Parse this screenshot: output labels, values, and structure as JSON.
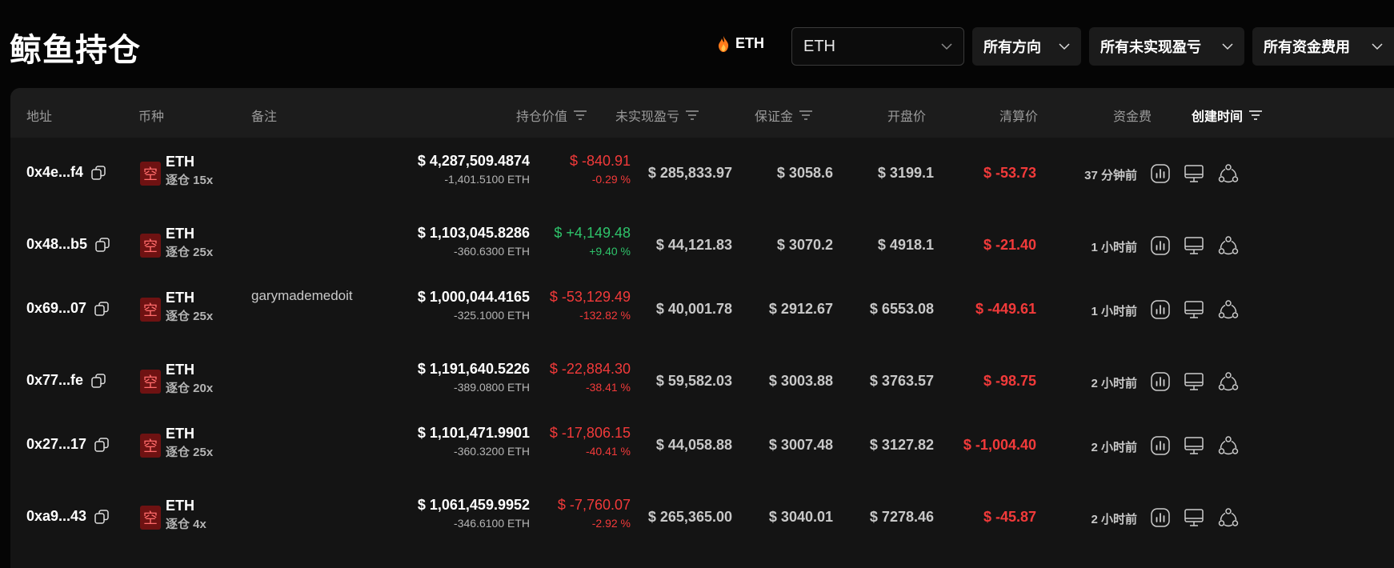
{
  "header": {
    "title": "鲸鱼持仓",
    "coin_tag": "ETH",
    "filters": {
      "coin_select": "ETH",
      "direction": "所有方向",
      "pnl": "所有未实现盈亏",
      "funding": "所有资金费用"
    }
  },
  "table": {
    "columns": {
      "address": "地址",
      "coin": "币种",
      "remark": "备注",
      "position_value": "持仓价值",
      "unrealized_pnl": "未实现盈亏",
      "margin": "保证金",
      "entry_price": "开盘价",
      "liq_price": "清算价",
      "funding": "资金费",
      "created": "创建时间"
    },
    "short_label": "空",
    "rows": [
      {
        "address": "0x4e...f4",
        "coin": "ETH",
        "leverage": "逐仓 15x",
        "remark": "",
        "value": "$ 4,287,509.4874",
        "size": "-1,401.5100 ETH",
        "pnl": "$ -840.91",
        "pnl_pct": "-0.29 %",
        "pnl_sign": "neg",
        "margin": "$ 285,833.97",
        "entry": "$ 3058.6",
        "liq": "$ 3199.1",
        "funding": "$ -53.73",
        "time": "37 分钟前"
      },
      {
        "address": "0x48...b5",
        "coin": "ETH",
        "leverage": "逐仓 25x",
        "remark": "",
        "value": "$ 1,103,045.8286",
        "size": "-360.6300 ETH",
        "pnl": "$ +4,149.48",
        "pnl_pct": "+9.40 %",
        "pnl_sign": "pos",
        "margin": "$ 44,121.83",
        "entry": "$ 3070.2",
        "liq": "$ 4918.1",
        "funding": "$ -21.40",
        "time": "1 小时前"
      },
      {
        "address": "0x69...07",
        "coin": "ETH",
        "leverage": "逐仓 25x",
        "remark": "garymademedoit",
        "value": "$ 1,000,044.4165",
        "size": "-325.1000 ETH",
        "pnl": "$ -53,129.49",
        "pnl_pct": "-132.82 %",
        "pnl_sign": "neg",
        "margin": "$ 40,001.78",
        "entry": "$ 2912.67",
        "liq": "$ 6553.08",
        "funding": "$ -449.61",
        "time": "1 小时前"
      },
      {
        "address": "0x77...fe",
        "coin": "ETH",
        "leverage": "逐仓 20x",
        "remark": "",
        "value": "$ 1,191,640.5226",
        "size": "-389.0800 ETH",
        "pnl": "$ -22,884.30",
        "pnl_pct": "-38.41 %",
        "pnl_sign": "neg",
        "margin": "$ 59,582.03",
        "entry": "$ 3003.88",
        "liq": "$ 3763.57",
        "funding": "$ -98.75",
        "time": "2 小时前"
      },
      {
        "address": "0x27...17",
        "coin": "ETH",
        "leverage": "逐仓 25x",
        "remark": "",
        "value": "$ 1,101,471.9901",
        "size": "-360.3200 ETH",
        "pnl": "$ -17,806.15",
        "pnl_pct": "-40.41 %",
        "pnl_sign": "neg",
        "margin": "$ 44,058.88",
        "entry": "$ 3007.48",
        "liq": "$ 3127.82",
        "funding": "$ -1,004.40",
        "time": "2 小时前"
      },
      {
        "address": "0xa9...43",
        "coin": "ETH",
        "leverage": "逐仓 4x",
        "remark": "",
        "value": "$ 1,061,459.9952",
        "size": "-346.6100 ETH",
        "pnl": "$ -7,760.07",
        "pnl_pct": "-2.92 %",
        "pnl_sign": "neg",
        "margin": "$ 265,365.00",
        "entry": "$ 3040.01",
        "liq": "$ 7278.46",
        "funding": "$ -45.87",
        "time": "2 小时前"
      }
    ]
  },
  "icons": {
    "flame": "flame-icon",
    "chevron": "chevron-down-icon",
    "sort": "filter-sort-icon",
    "copy": "copy-icon",
    "chart": "chart-icon",
    "monitor": "monitor-icon",
    "share": "share-icon"
  },
  "colors": {
    "negative": "#f23a3a",
    "positive": "#2ec36a",
    "short_badge": "#6e1212"
  }
}
